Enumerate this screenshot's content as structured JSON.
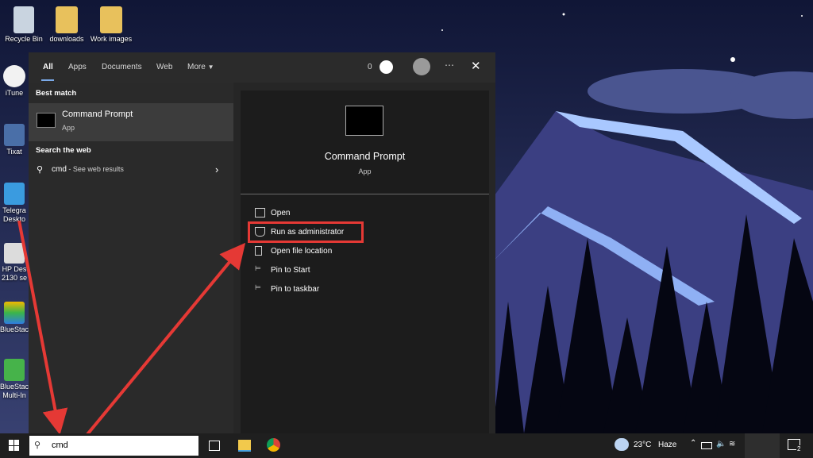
{
  "desktop": {
    "icons": [
      {
        "label": "Recycle Bin"
      },
      {
        "label": "downloads"
      },
      {
        "label": "Work images"
      },
      {
        "label": "iTune"
      },
      {
        "label": "Tixat"
      },
      {
        "label": "Telegra Deskto"
      },
      {
        "label": "HP Des 2130 se"
      },
      {
        "label": "BlueStac"
      },
      {
        "label": "BlueStac Multi-In"
      }
    ]
  },
  "start_menu": {
    "tabs": [
      "All",
      "Apps",
      "Documents",
      "Web",
      "More"
    ],
    "points": "0",
    "best_match_header": "Best match",
    "best_match": {
      "title": "Command Prompt",
      "subtitle": "App"
    },
    "web_header": "Search the web",
    "web_result": {
      "query": "cmd",
      "suffix": " - See web results"
    },
    "preview": {
      "title": "Command Prompt",
      "subtitle": "App"
    },
    "actions": [
      {
        "label": "Open",
        "icon": "open-icon"
      },
      {
        "label": "Run as administrator",
        "icon": "shield-icon"
      },
      {
        "label": "Open file location",
        "icon": "file-location-icon"
      },
      {
        "label": "Pin to Start",
        "icon": "pin-icon"
      },
      {
        "label": "Pin to taskbar",
        "icon": "pin-icon"
      }
    ]
  },
  "taskbar": {
    "search_value": "cmd",
    "weather_temp": "23°C",
    "weather_desc": "Haze",
    "notification_count": "2"
  },
  "colors": {
    "accent": "#7aa9e8",
    "highlight": "#e53935"
  }
}
